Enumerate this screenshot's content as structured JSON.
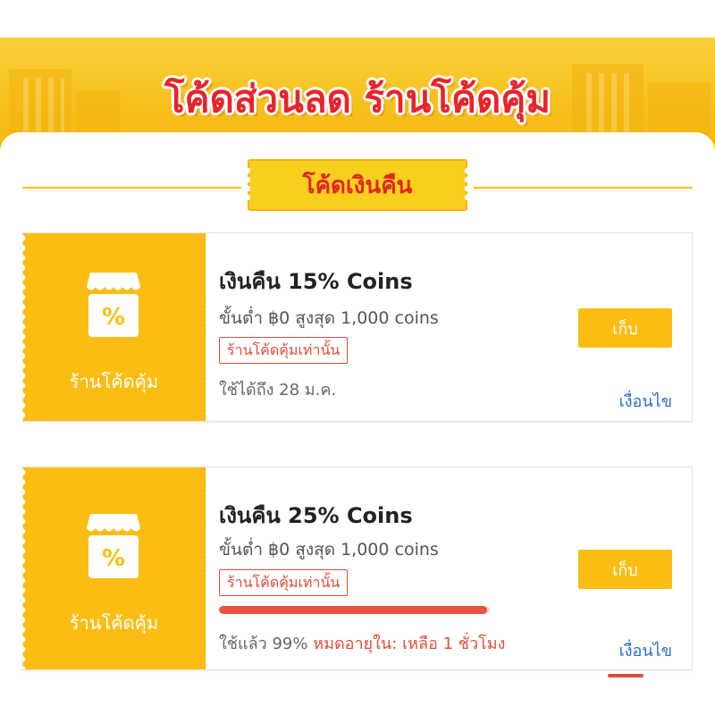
{
  "banner": {
    "title": "โค้ดส่วนลด ร้านโค้ดคุ้ม"
  },
  "section": {
    "title": "โค้ดเงินคืน"
  },
  "colors": {
    "accent": "#fbbd14",
    "title_red": "#e9232b",
    "link_blue": "#2c6cd1",
    "tag_red": "#e24b3a"
  },
  "vouchers": [
    {
      "shop_icon": "percent-shop-icon",
      "shop_label": "ร้านโค้ดคุ้ม",
      "title": "เงินคืน 15% Coins",
      "min_spend": "ขั้นต่ำ ฿0 สูงสุด 1,000 coins",
      "tag": "ร้านโค้ดคุ้มเท่านั้น",
      "valid_until": "ใช้ได้ถึง 28 ม.ค.",
      "collect_label": "เก็บ",
      "terms_label": "เงื่อนไข"
    },
    {
      "shop_icon": "percent-shop-icon",
      "shop_label": "ร้านโค้ดคุ้ม",
      "title": "เงินคืน 25% Coins",
      "min_spend": "ขั้นต่ำ ฿0 สูงสุด 1,000 coins",
      "tag": "ร้านโค้ดคุ้มเท่านั้น",
      "usage_percent": 99,
      "used_text": "ใช้แล้ว 99%",
      "expiry_text": "หมดอายุใน:  เหลือ 1 ชั่วโมง",
      "collect_label": "เก็บ",
      "terms_label": "เงื่อนไข"
    }
  ]
}
